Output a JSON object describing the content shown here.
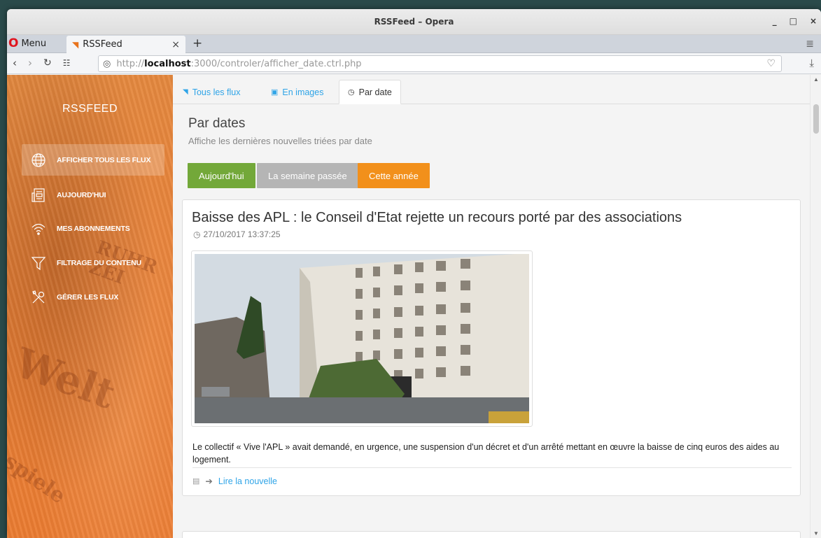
{
  "window": {
    "title": "RSSFeed – Opera",
    "controls": [
      "_",
      "□",
      "×"
    ]
  },
  "browser": {
    "menu_label": "Menu",
    "tab_title": "RSSFeed",
    "tab_close": "×",
    "new_tab": "+",
    "url_prefix": "http://",
    "url_host": "localhost",
    "url_rest": ":3000/controler/afficher_date.ctrl.php"
  },
  "sidebar": {
    "brand": "RSSFEED",
    "items": [
      {
        "label": "AFFICHER TOUS LES FLUX",
        "icon": "globe-icon"
      },
      {
        "label": "AUJOURD'HUI",
        "icon": "newspaper-icon"
      },
      {
        "label": "MES ABONNEMENTS",
        "icon": "wifi-icon"
      },
      {
        "label": "FILTRAGE DU CONTENU",
        "icon": "filter-icon"
      },
      {
        "label": "GÉRER LES FLUX",
        "icon": "tools-icon"
      }
    ]
  },
  "content_tabs": [
    {
      "label": "Tous les flux",
      "icon": "rss-icon"
    },
    {
      "label": "En images",
      "icon": "image-icon"
    },
    {
      "label": "Par date",
      "icon": "clock-icon"
    }
  ],
  "section": {
    "title": "Par dates",
    "subtitle": "Affiche les dernières nouvelles triées par date"
  },
  "filters": {
    "today": "Aujourd'hui",
    "last_week": "La semaine passée",
    "this_year": "Cette année"
  },
  "article": {
    "title": "Baisse des APL : le Conseil d'Etat rejette un recours porté par des associations",
    "date": "27/10/2017 13:37:25",
    "text": "Le collectif « Vive l'APL » avait demandé, en urgence, une suspension d'un décret et d'un arrêté mettant en œuvre la baisse de cinq euros des aides au logement.",
    "link_label": "Lire la nouvelle"
  },
  "colors": {
    "accent_blue": "#2fa4e7",
    "green": "#73a839",
    "grey": "#b5b5b5",
    "orange": "#f2901b",
    "sidebar": "#e8833a"
  }
}
